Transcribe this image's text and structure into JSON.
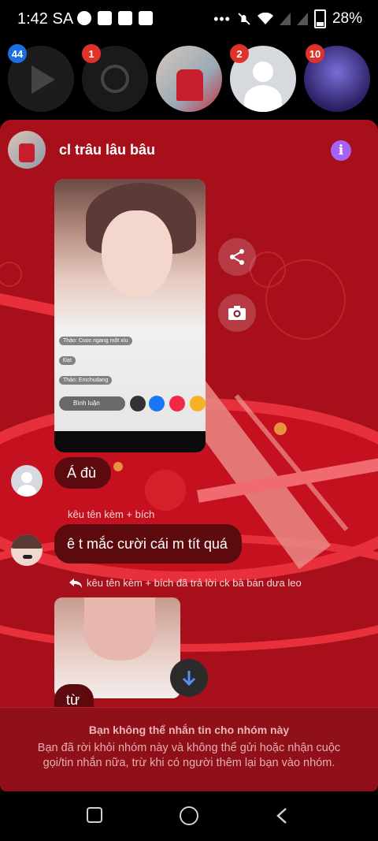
{
  "status_bar": {
    "time": "1:42 SA",
    "battery": "28%"
  },
  "chat_heads": [
    {
      "name": "video",
      "badge": "44",
      "badge_color": "#1c6fe0"
    },
    {
      "name": "messenger",
      "badge": "1",
      "badge_color": "#e0322b"
    },
    {
      "name": "chat-photo",
      "badge": ""
    },
    {
      "name": "default-avatar",
      "badge": "2",
      "badge_color": "#e0322b"
    },
    {
      "name": "galaxy",
      "badge": "10",
      "badge_color": "#e0322b"
    }
  ],
  "chat": {
    "title": "cl trâu lâu bâu",
    "accent": "#a463f2",
    "screenshot_comments": [
      {
        "name": "Thảo",
        "text": "Cuoc ngang một xíu"
      },
      {
        "name": "Đạt",
        "text": ""
      },
      {
        "name": "Thảo",
        "text": "Emchudang"
      }
    ],
    "screenshot_comment_bar": "Bình luận",
    "messages": [
      {
        "text": "Á đù"
      },
      {
        "sender": "kêu tên kèm + bích",
        "text": "ê t mắc cười cái m tít quá"
      }
    ],
    "reply_note": "kêu tên kèm + bích đã trả lời ck bà bán dưa leo",
    "partial_message": "từ"
  },
  "notice": {
    "title": "Bạn không thể nhắn tin cho nhóm này",
    "body": "Bạn đã rời khỏi nhóm này và không thể gửi hoặc nhận cuộc gọi/tin nhắn nữa, trừ khi có người thêm lại bạn vào nhóm."
  }
}
